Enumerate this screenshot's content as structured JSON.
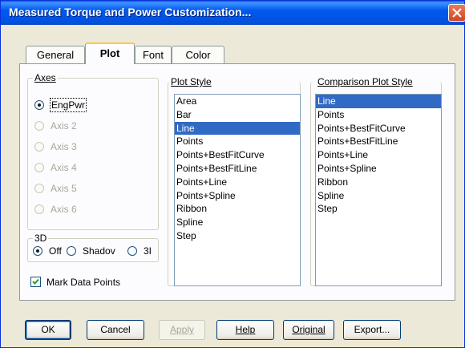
{
  "window": {
    "title": "Measured Torque and Power Customization..."
  },
  "tabs": [
    "General",
    "Plot",
    "Font",
    "Color"
  ],
  "active_tab": "Plot",
  "axes": {
    "label": "Axes",
    "options": [
      {
        "label": "EngPwr",
        "checked": true,
        "enabled": true
      },
      {
        "label": "Axis 2",
        "checked": false,
        "enabled": false
      },
      {
        "label": "Axis 3",
        "checked": false,
        "enabled": false
      },
      {
        "label": "Axis 4",
        "checked": false,
        "enabled": false
      },
      {
        "label": "Axis 5",
        "checked": false,
        "enabled": false
      },
      {
        "label": "Axis 6",
        "checked": false,
        "enabled": false
      }
    ]
  },
  "threed": {
    "label": "3D",
    "options": [
      {
        "label": "Off",
        "checked": true
      },
      {
        "label": "Shadov",
        "checked": false
      },
      {
        "label": "3I",
        "checked": false
      }
    ]
  },
  "mark_data_points": {
    "label": "Mark Data Points",
    "checked": true
  },
  "plot_style": {
    "label": "Plot Style",
    "items": [
      "Area",
      "Bar",
      "Line",
      "Points",
      "Points+BestFitCurve",
      "Points+BestFitLine",
      "Points+Line",
      "Points+Spline",
      "Ribbon",
      "Spline",
      "Step"
    ],
    "selected": "Line"
  },
  "comparison_plot_style": {
    "label": "Comparison Plot Style",
    "items": [
      "Line",
      "Points",
      "Points+BestFitCurve",
      "Points+BestFitLine",
      "Points+Line",
      "Points+Spline",
      "Ribbon",
      "Spline",
      "Step"
    ],
    "selected": "Line"
  },
  "buttons": {
    "ok": "OK",
    "cancel": "Cancel",
    "apply": "Apply",
    "help": "Help",
    "original": "Original",
    "export": "Export..."
  },
  "colors": {
    "titlebar": "#0058ee",
    "selection": "#316ac5",
    "dialog_bg": "#ece9d8"
  }
}
